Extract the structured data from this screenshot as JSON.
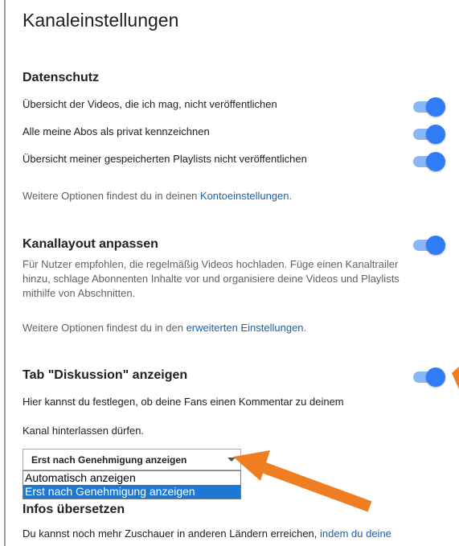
{
  "page": {
    "title": "Kanaleinstellungen"
  },
  "privacy": {
    "heading": "Datenschutz",
    "items": [
      {
        "label": "Übersicht der Videos, die ich mag, nicht veröffentlichen",
        "on": true
      },
      {
        "label": "Alle meine Abos als privat kennzeichnen",
        "on": true
      },
      {
        "label": "Übersicht meiner gespeicherten Playlists nicht veröffentlichen",
        "on": true
      }
    ],
    "more_prefix": "Weitere Optionen findest du in deinen ",
    "more_link": "Kontoeinstellungen",
    "more_suffix": "."
  },
  "layout": {
    "heading": "Kanallayout anpassen",
    "on": true,
    "description": "Für Nutzer empfohlen, die regelmäßig Videos hochladen. Füge einen Kanaltrailer hinzu, schlage Abonnenten Inhalte vor und organisiere deine Videos und Playlists mithilfe von Abschnitten.",
    "more_prefix": "Weitere Optionen findest du in den ",
    "more_link": "erweiterten Einstellungen",
    "more_suffix": "."
  },
  "discussion": {
    "heading": "Tab \"Diskussion\" anzeigen",
    "on": true,
    "line1": "Hier kannst du festlegen, ob deine Fans einen Kommentar zu deinem",
    "line2": "Kanal hinterlassen dürfen.",
    "select_value": "Erst nach Genehmigung anzeigen",
    "options": [
      "Automatisch anzeigen",
      "Erst nach Genehmigung anzeigen"
    ],
    "selected_index": 1
  },
  "translate": {
    "heading": "Infos übersetzen",
    "text_prefix": "Du kannst noch mehr Zuschauer in anderen Ländern erreichen, ",
    "text_link": "indem du deine"
  },
  "colors": {
    "toggle_on": "#2f7cf6",
    "link": "#1a5fb4",
    "annotation_arrow": "#ef7d22"
  }
}
